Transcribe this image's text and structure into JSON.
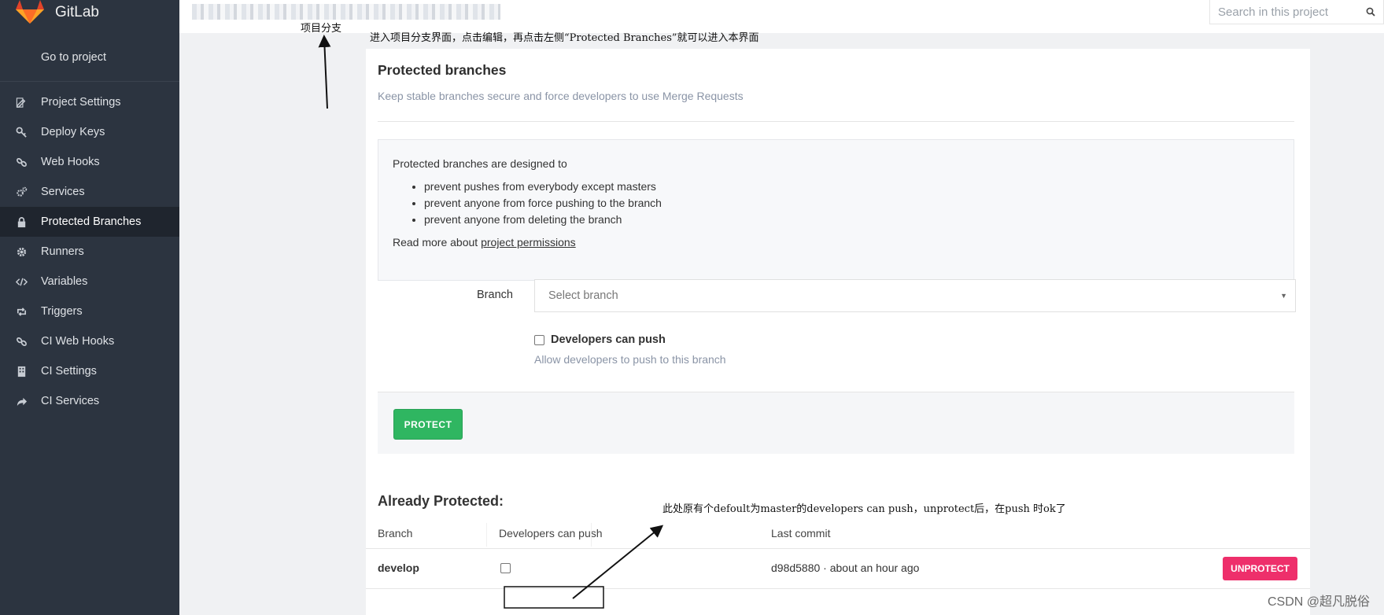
{
  "app": {
    "name": "GitLab",
    "brand_color": "#e24329"
  },
  "sidebar": {
    "goto_label": "Go to project",
    "items": [
      {
        "label": "Project Settings",
        "icon": "edit-icon"
      },
      {
        "label": "Deploy Keys",
        "icon": "key-icon"
      },
      {
        "label": "Web Hooks",
        "icon": "link-icon"
      },
      {
        "label": "Services",
        "icon": "cogs-icon"
      },
      {
        "label": "Protected Branches",
        "icon": "lock-icon",
        "active": true
      },
      {
        "label": "Runners",
        "icon": "gear-icon"
      },
      {
        "label": "Variables",
        "icon": "code-icon"
      },
      {
        "label": "Triggers",
        "icon": "retweet-icon"
      },
      {
        "label": "CI Web Hooks",
        "icon": "link-icon"
      },
      {
        "label": "CI Settings",
        "icon": "building-icon"
      },
      {
        "label": "CI Services",
        "icon": "share-icon"
      }
    ]
  },
  "header": {
    "search_placeholder": "Search in this project"
  },
  "annotations": {
    "branch_note": "项目分支",
    "instructions": "进入项目分支界面，点击编辑，再点击左侧“Protected Branches”就可以进入本界面",
    "push_note": "此处原有个defoult为master的developers can push，unprotect后，在push 时ok了"
  },
  "main": {
    "title": "Protected branches",
    "subtitle": "Keep stable branches secure and force developers to use Merge Requests",
    "info": {
      "intro": "Protected branches are designed to",
      "bullets": [
        "prevent pushes from everybody except masters",
        "prevent anyone from force pushing to the branch",
        "prevent anyone from deleting the branch"
      ],
      "read_more_prefix": "Read more about ",
      "read_more_link": "project permissions"
    },
    "form": {
      "branch_label": "Branch",
      "branch_placeholder": "Select branch",
      "dev_push_label": "Developers can push",
      "dev_push_hint": "Allow developers to push to this branch",
      "dev_push_checked": false,
      "protect_button": "PROTECT"
    },
    "already": {
      "heading": "Already Protected:",
      "columns": [
        "Branch",
        "Developers can push",
        "Last commit"
      ],
      "rows": [
        {
          "branch": "develop",
          "dev_can_push": false,
          "last_commit": "d98d5880 · about an hour ago",
          "action": "UNPROTECT"
        }
      ]
    }
  },
  "watermark": "CSDN @超凡脱俗"
}
